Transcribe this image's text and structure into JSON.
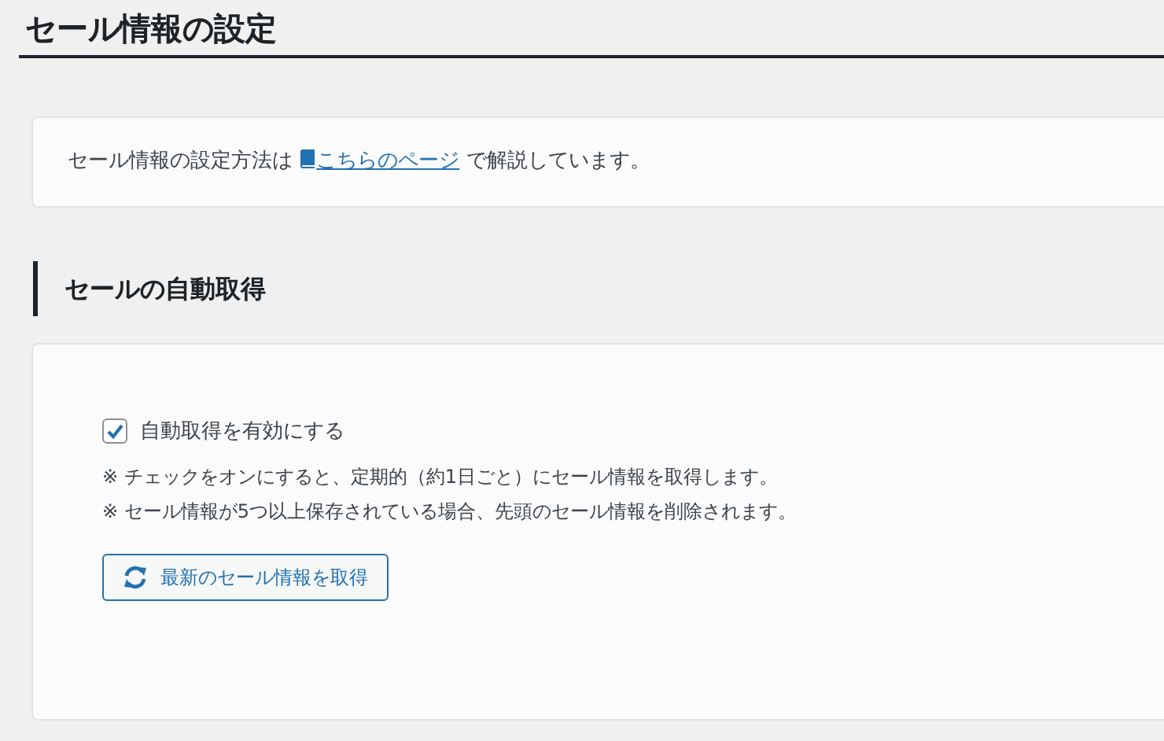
{
  "page_title": "セール情報の設定",
  "intro": {
    "before": "セール情報の設定方法は",
    "link": "こちらのページ",
    "after": "で解説しています。"
  },
  "section": {
    "title": "セールの自動取得",
    "checkbox": {
      "label": "自動取得を有効にする",
      "checked": true
    },
    "notes": [
      "※ チェックをオンにすると、定期的（約1日ごと）にセール情報を取得します。",
      "※ セール情報が5つ以上保存されている場合、先頭のセール情報を削除されます。"
    ],
    "button": "最新のセール情報を取得"
  }
}
